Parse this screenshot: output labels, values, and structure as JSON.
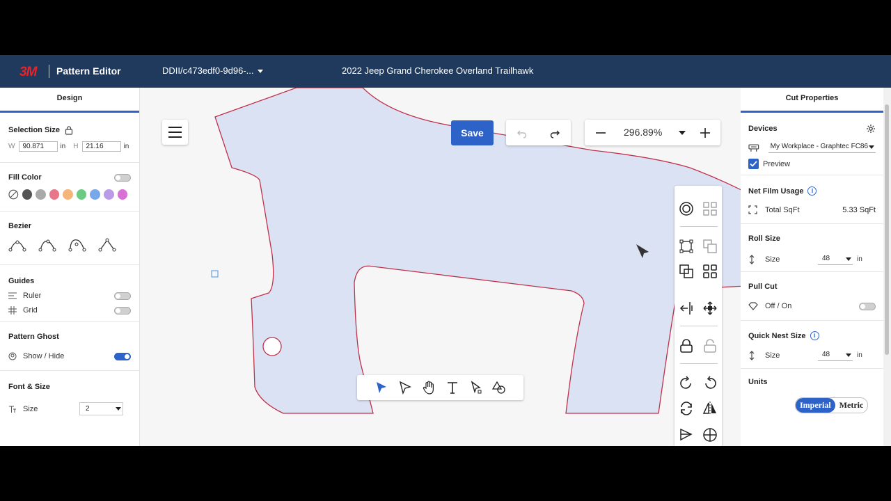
{
  "header": {
    "logo": "3M",
    "app_title": "Pattern Editor",
    "document_id": "DDII/c473edf0-9d96-...",
    "vehicle": "2022 Jeep Grand Cherokee Overland Trailhawk"
  },
  "left_panel": {
    "tab": "Design",
    "selection_size": {
      "title": "Selection Size",
      "w_label": "W",
      "w_value": "90.871",
      "w_unit": "in",
      "h_label": "H",
      "h_value": "21.16",
      "h_unit": "in"
    },
    "fill_color": {
      "title": "Fill Color",
      "swatches": [
        "#555555",
        "#a9a9a9",
        "#e8768a",
        "#f5b57a",
        "#6ccb83",
        "#79a8ea",
        "#b99be8",
        "#d870d6"
      ]
    },
    "bezier": {
      "title": "Bezier"
    },
    "guides": {
      "title": "Guides",
      "ruler": "Ruler",
      "grid": "Grid"
    },
    "pattern_ghost": {
      "title": "Pattern Ghost",
      "show_hide": "Show / Hide"
    },
    "font_size": {
      "title": "Font & Size",
      "size_label": "Size",
      "size_value": "2"
    }
  },
  "canvas": {
    "save_label": "Save",
    "zoom_value": "296.89%"
  },
  "right_panel": {
    "tab": "Cut Properties",
    "devices": {
      "title": "Devices",
      "device": "My Workplace - Graphtec FC86",
      "preview": "Preview"
    },
    "net_film": {
      "title": "Net Film Usage",
      "total_label": "Total SqFt",
      "total_value": "5.33 SqFt"
    },
    "roll_size": {
      "title": "Roll Size",
      "size_label": "Size",
      "size_value": "48",
      "unit": "in"
    },
    "pull_cut": {
      "title": "Pull Cut",
      "label": "Off / On"
    },
    "quick_nest": {
      "title": "Quick Nest Size",
      "size_label": "Size",
      "size_value": "48",
      "unit": "in"
    },
    "units": {
      "title": "Units",
      "imperial": "Imperial",
      "metric": "Metric"
    }
  },
  "colors": {
    "accent": "#2d62c9",
    "header_bg": "#1f3a5c",
    "pattern_fill": "#dbe2f3",
    "pattern_stroke": "#c0304a"
  }
}
